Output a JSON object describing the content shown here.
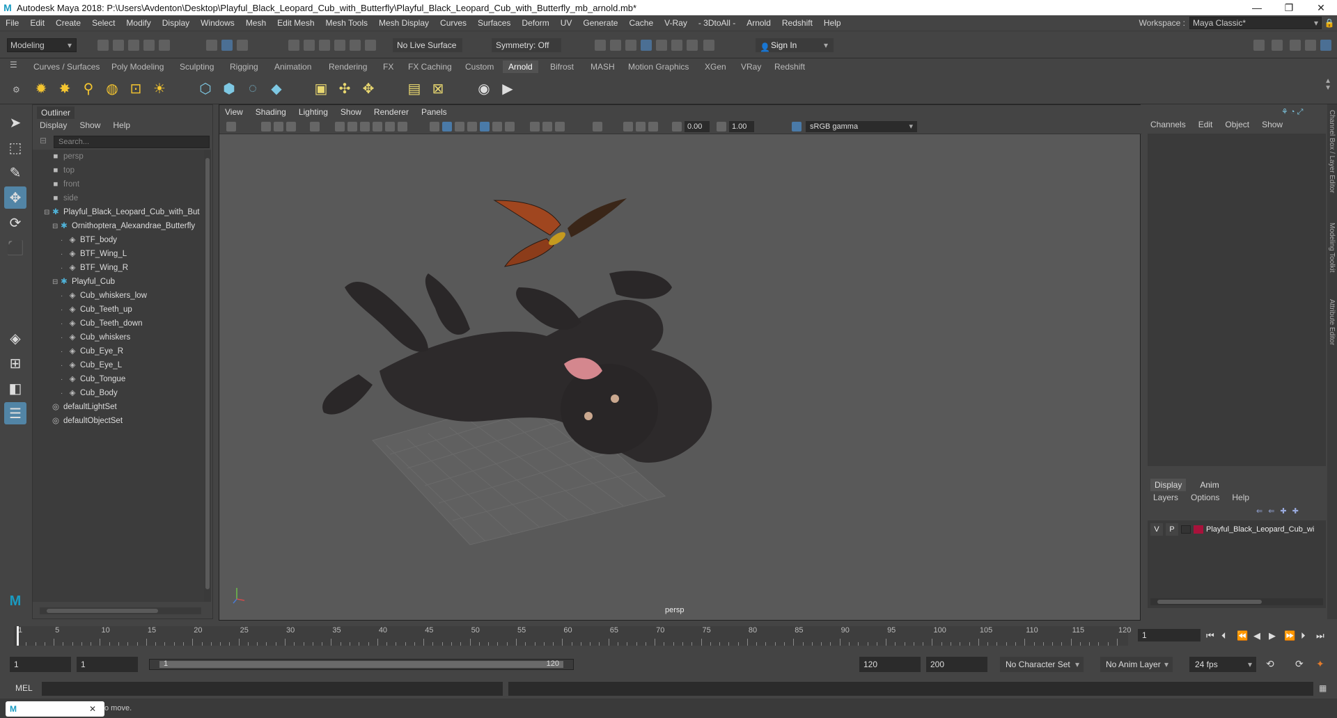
{
  "window": {
    "title": "Autodesk Maya 2018: P:\\Users\\Avdenton\\Desktop\\Playful_Black_Leopard_Cub_with_Butterfly\\Playful_Black_Leopard_Cub_with_Butterfly_mb_arnold.mb*",
    "controls": [
      "—",
      "❐",
      "✕"
    ]
  },
  "menubar": {
    "items": [
      "File",
      "Edit",
      "Create",
      "Select",
      "Modify",
      "Display",
      "Windows",
      "Mesh",
      "Edit Mesh",
      "Mesh Tools",
      "Mesh Display",
      "Curves",
      "Surfaces",
      "Deform",
      "UV",
      "Generate",
      "Cache",
      "V-Ray",
      "- 3DtoAll -",
      "Arnold",
      "Redshift",
      "Help"
    ],
    "workspace_label": "Workspace :",
    "workspace_value": "Maya Classic*"
  },
  "statusline": {
    "mode": "Modeling",
    "live_surface": "No Live Surface",
    "symmetry": "Symmetry: Off",
    "sign_in": "Sign In"
  },
  "shelf": {
    "tabs": [
      "Curves / Surfaces",
      "Poly Modeling",
      "Sculpting",
      "Rigging",
      "Animation",
      "Rendering",
      "FX",
      "FX Caching",
      "Custom",
      "Arnold",
      "Bifrost",
      "MASH",
      "Motion Graphics",
      "XGen",
      "VRay",
      "Redshift"
    ],
    "active_tab": "Arnold"
  },
  "outliner": {
    "title": "Outliner",
    "menu": [
      "Display",
      "Show",
      "Help"
    ],
    "search_placeholder": "Search...",
    "rows": [
      {
        "label": "persp",
        "dim": true,
        "indent": 0,
        "icon": "camera"
      },
      {
        "label": "top",
        "dim": true,
        "indent": 0,
        "icon": "camera"
      },
      {
        "label": "front",
        "dim": true,
        "indent": 0,
        "icon": "camera"
      },
      {
        "label": "side",
        "dim": true,
        "indent": 0,
        "icon": "camera"
      },
      {
        "label": "Playful_Black_Leopard_Cub_with_But",
        "dim": false,
        "indent": 0,
        "icon": "group",
        "exp": "⊟"
      },
      {
        "label": "Ornithoptera_Alexandrae_Butterfly",
        "dim": false,
        "indent": 1,
        "icon": "group",
        "exp": "⊟"
      },
      {
        "label": "BTF_body",
        "dim": false,
        "indent": 2,
        "icon": "mesh"
      },
      {
        "label": "BTF_Wing_L",
        "dim": false,
        "indent": 2,
        "icon": "mesh"
      },
      {
        "label": "BTF_Wing_R",
        "dim": false,
        "indent": 2,
        "icon": "mesh"
      },
      {
        "label": "Playful_Cub",
        "dim": false,
        "indent": 1,
        "icon": "group",
        "exp": "⊟"
      },
      {
        "label": "Cub_whiskers_low",
        "dim": false,
        "indent": 2,
        "icon": "mesh"
      },
      {
        "label": "Cub_Teeth_up",
        "dim": false,
        "indent": 2,
        "icon": "mesh"
      },
      {
        "label": "Cub_Teeth_down",
        "dim": false,
        "indent": 2,
        "icon": "mesh"
      },
      {
        "label": "Cub_whiskers",
        "dim": false,
        "indent": 2,
        "icon": "mesh"
      },
      {
        "label": "Cub_Eye_R",
        "dim": false,
        "indent": 2,
        "icon": "mesh"
      },
      {
        "label": "Cub_Eye_L",
        "dim": false,
        "indent": 2,
        "icon": "mesh"
      },
      {
        "label": "Cub_Tongue",
        "dim": false,
        "indent": 2,
        "icon": "mesh"
      },
      {
        "label": "Cub_Body",
        "dim": false,
        "indent": 2,
        "icon": "mesh"
      },
      {
        "label": "defaultLightSet",
        "dim": false,
        "indent": 0,
        "icon": "set"
      },
      {
        "label": "defaultObjectSet",
        "dim": false,
        "indent": 0,
        "icon": "set"
      }
    ]
  },
  "viewport": {
    "menu": [
      "View",
      "Shading",
      "Lighting",
      "Show",
      "Renderer",
      "Panels"
    ],
    "exposure": "0.00",
    "gamma": "1.00",
    "color_space": "sRGB gamma",
    "camera": "persp"
  },
  "channelbox": {
    "menu": [
      "Channels",
      "Edit",
      "Object",
      "Show"
    ],
    "side_tabs": [
      "Channel Box / Layer Editor",
      "Modeling Toolkit",
      "Attribute Editor"
    ]
  },
  "layers": {
    "tabs": [
      "Display",
      "Anim"
    ],
    "active_tab": "Display",
    "menu": [
      "Layers",
      "Options",
      "Help"
    ],
    "row": {
      "v": "V",
      "p": "P",
      "name": "Playful_Black_Leopard_Cub_wi",
      "color": "#a8123b"
    }
  },
  "timeline": {
    "ticks": [
      "1",
      "5",
      "10",
      "15",
      "20",
      "25",
      "30",
      "35",
      "40",
      "45",
      "50",
      "55",
      "60",
      "65",
      "70",
      "75",
      "80",
      "85",
      "90",
      "95",
      "100",
      "105",
      "110",
      "115",
      "120"
    ],
    "current_frame": "1"
  },
  "range": {
    "start": "1",
    "playback_start": "1",
    "slider_start": "1",
    "slider_end": "120",
    "playback_end": "120",
    "end": "200",
    "character_set": "No Character Set",
    "anim_layer": "No Anim Layer",
    "fps": "24 fps"
  },
  "mel": {
    "label": "MEL"
  },
  "help": {
    "text": "o move."
  }
}
